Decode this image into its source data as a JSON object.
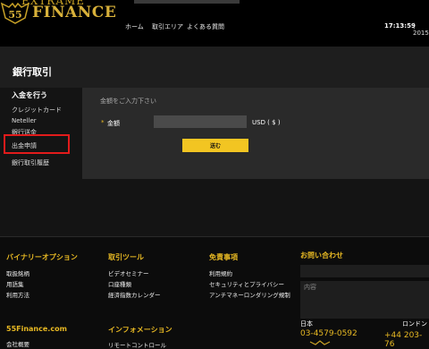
{
  "header": {
    "logo_top": "EXTRAME",
    "logo_badge": "55",
    "logo_name": "FINANCE",
    "nav": [
      "ホーム",
      "取引エリア",
      "よくある質問"
    ],
    "clock": "17:13:59",
    "clock_rest": "| 2015"
  },
  "page": {
    "title": "銀行取引"
  },
  "sidebar": {
    "heading": "入金を行う",
    "items": [
      "クレジットカード",
      "Neteller",
      "銀行送金",
      "出金申請",
      "銀行取引履歴"
    ]
  },
  "form": {
    "hint": "金額をご入力下さい",
    "required_mark": "*",
    "amount_label": "金額",
    "amount_value": "",
    "unit": "USD ( $ )",
    "submit": "送む"
  },
  "footer": {
    "col1": {
      "heading": "バイナリーオプション",
      "links": [
        "取扱銘柄",
        "用語集",
        "利用方法"
      ]
    },
    "col2": {
      "heading": "取引ツール",
      "links": [
        "ビデオセミナー",
        "口座種類",
        "経済指数カレンダー"
      ]
    },
    "col3": {
      "heading": "免責事項",
      "links": [
        "利用規約",
        "セキュリティとプライバシー",
        "アンチマネーロンダリング規制"
      ]
    },
    "col4": {
      "heading": "お問い合わせ",
      "message_placeholder": "内容"
    },
    "col5": {
      "heading": "55Finance.com",
      "links": [
        "会社概要"
      ]
    },
    "col6": {
      "heading": "インフォメーション",
      "links": [
        "リモートコントロール"
      ]
    },
    "contact": {
      "japan_label": "日本",
      "japan_phone": "03-4579-0592",
      "london_label": "ロンドン",
      "london_phone": "+44 203-76"
    }
  },
  "colors": {
    "accent": "#e8b923",
    "button": "#f2c522",
    "highlight": "#e21b1b",
    "panel": "#2a2a2a"
  }
}
